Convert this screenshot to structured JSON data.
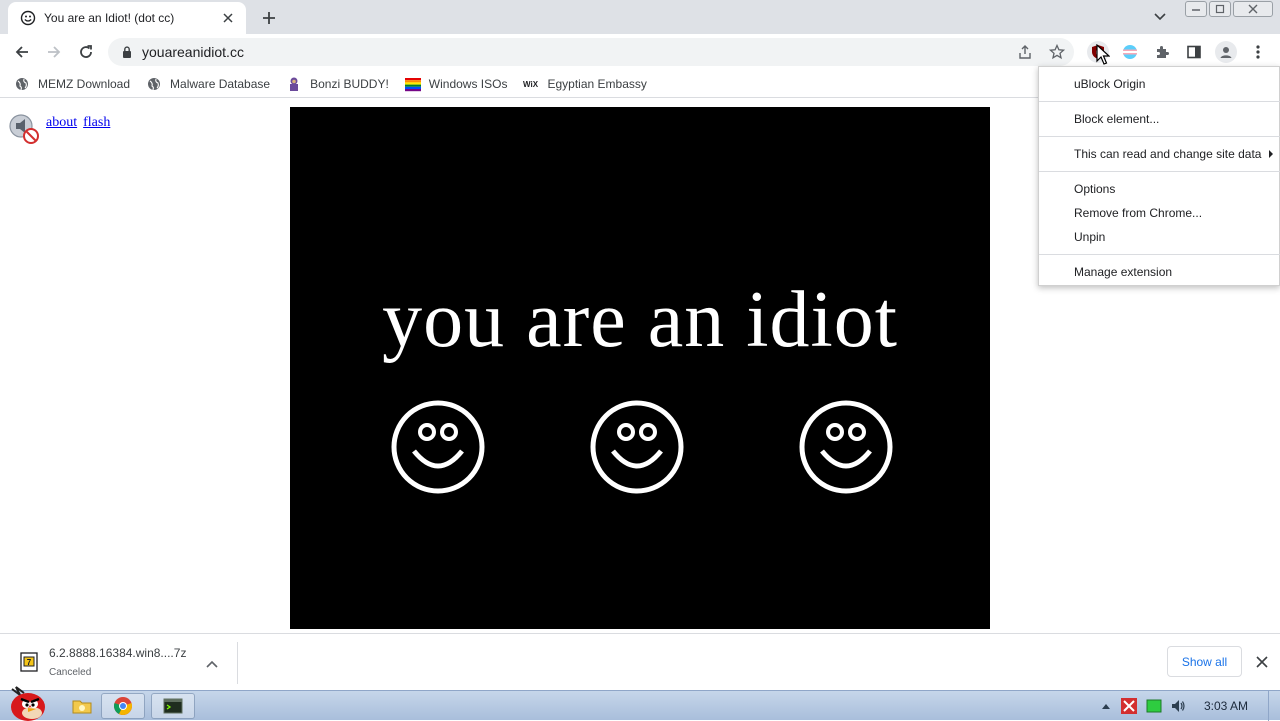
{
  "tab": {
    "title": "You are an Idiot! (dot cc)"
  },
  "toolbar": {
    "url": "youareanidiot.cc"
  },
  "bookmarks": [
    {
      "label": "MEMZ Download",
      "icon": "globe-icon"
    },
    {
      "label": "Malware Database",
      "icon": "globe-icon"
    },
    {
      "label": "Bonzi BUDDY!",
      "icon": "bonzi-icon"
    },
    {
      "label": "Windows ISOs",
      "icon": "windows-flag-icon"
    },
    {
      "label": "Egyptian Embassy",
      "icon": "wix-icon"
    }
  ],
  "page": {
    "links": [
      "about",
      "flash"
    ],
    "headline": "you are an idiot"
  },
  "context_menu": {
    "items": [
      "uBlock Origin",
      "Block element...",
      "This can read and change site data",
      "Options",
      "Remove from Chrome...",
      "Unpin",
      "Manage extension"
    ]
  },
  "download": {
    "filename": "6.2.8888.16384.win8....7z",
    "status": "Canceled",
    "show_all": "Show all"
  },
  "taskbar": {
    "clock": "3:03 AM"
  },
  "colors": {
    "accent": "#1a73e8",
    "link": "#0000ee",
    "ublock_red": "#800000",
    "taskbar": "#b7c9e2"
  }
}
